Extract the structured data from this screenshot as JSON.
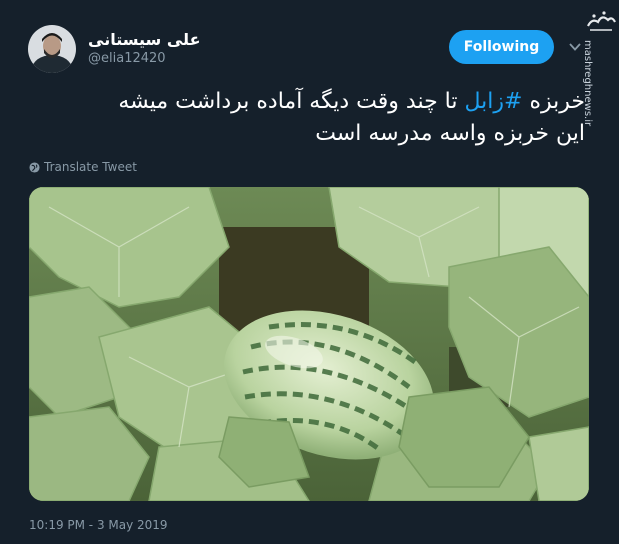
{
  "user": {
    "display_name": "علی سیستانی",
    "handle": "@elia12420"
  },
  "follow_button": {
    "label": "Following"
  },
  "tweet": {
    "line1_pre": "خربزه ",
    "hashtag": "#زابل",
    "line1_post": " تا چند وقت دیگه آماده برداشت میشه",
    "line2": "این خربزه واسه مدرسه است"
  },
  "translate": {
    "label": "Translate Tweet"
  },
  "timestamp": "10:19 PM - 3 May 2019",
  "watermark": {
    "site": "mashreghnews.ir",
    "logo_text": "مشرق"
  },
  "colors": {
    "background": "#15202b",
    "accent": "#1da1f2",
    "muted": "#8899a6"
  },
  "icons": {
    "caret": "chevron-down-icon",
    "globe": "globe-icon"
  }
}
